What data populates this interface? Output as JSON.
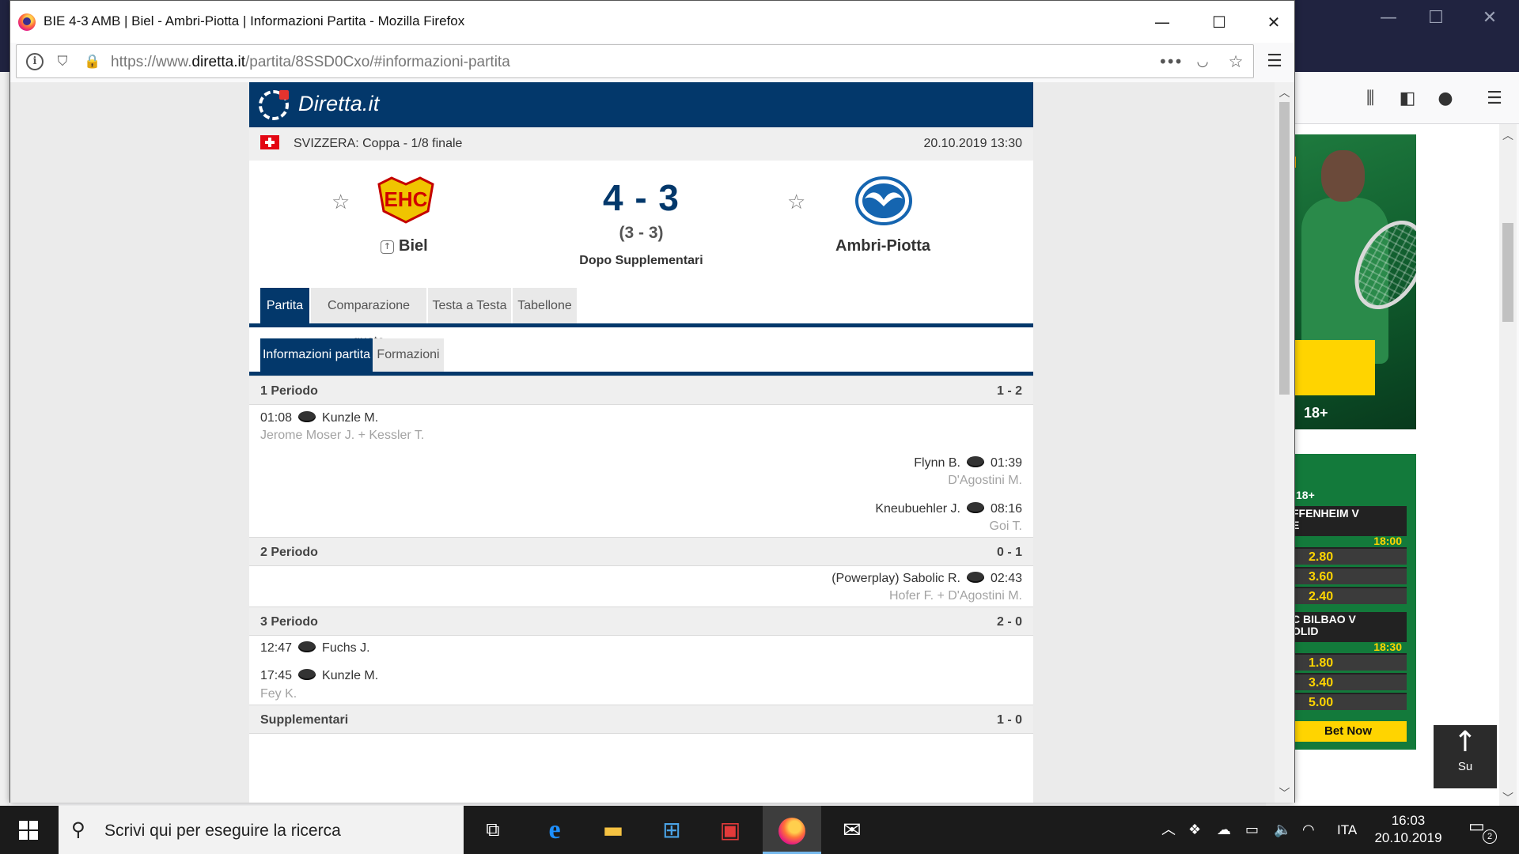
{
  "window": {
    "title": "BIE 4-3 AMB | Biel - Ambri-Piotta | Informazioni Partita - Mozilla Firefox",
    "url_prefix": "https://www.",
    "url_host": "diretta.it",
    "url_path": "/partita/8SSD0Cxo/#informazioni-partita"
  },
  "site": {
    "logo_text": "Diretta.it"
  },
  "competition": {
    "name": "SVIZZERA: Coppa - 1/8 finale",
    "datetime": "20.10.2019 13:30"
  },
  "match": {
    "home_team": "Biel",
    "away_team": "Ambri-Piotta",
    "score": "4 - 3",
    "score_regular": "(3 - 3)",
    "status": "Dopo Supplementari"
  },
  "tabs": [
    "Partita",
    "Comparazione quote",
    "Testa a Testa",
    "Tabellone"
  ],
  "subtabs": [
    "Informazioni partita",
    "Formazioni"
  ],
  "periods": [
    {
      "name": "1 Periodo",
      "result": "1 - 2",
      "events": [
        {
          "side": "home",
          "time": "01:08",
          "player": "Kunzle M.",
          "assist": "Jerome Moser J. + Kessler T."
        },
        {
          "side": "away",
          "time": "01:39",
          "player": "Flynn B.",
          "assist": "D'Agostini M."
        },
        {
          "side": "away",
          "time": "08:16",
          "player": "Kneubuehler J.",
          "assist": "Goi T."
        }
      ]
    },
    {
      "name": "2 Periodo",
      "result": "0 - 1",
      "events": [
        {
          "side": "away",
          "time": "02:43",
          "player": "(Powerplay) Sabolic R.",
          "assist": "Hofer F. + D'Agostini M."
        }
      ]
    },
    {
      "name": "3 Periodo",
      "result": "2 - 0",
      "events": [
        {
          "side": "home",
          "time": "12:47",
          "player": "Fuchs J.",
          "assist": ""
        },
        {
          "side": "home",
          "time": "17:45",
          "player": "Kunzle M.",
          "assist": "Fey K."
        }
      ]
    },
    {
      "name": "Supplementari",
      "result": "1 - 0",
      "events": []
    }
  ],
  "ads": {
    "tennis_age": "18+",
    "bet_age": "18+",
    "bets": [
      {
        "teams": "FFENHEIM V\nE",
        "time": "18:00",
        "odds": [
          "2.80",
          "3.60",
          "2.40"
        ]
      },
      {
        "teams": "C BILBAO V\nOLID",
        "time": "18:30",
        "odds": [
          "1.80",
          "3.40",
          "5.00"
        ]
      }
    ],
    "bet_button": "Bet Now"
  },
  "scroll_up_label": "Su",
  "taskbar": {
    "search_placeholder": "Scrivi qui per eseguire la ricerca",
    "language": "ITA",
    "time": "16:03",
    "date": "20.10.2019",
    "notifications": "2"
  },
  "colors": {
    "brand": "#03386b",
    "accent_red": "#e4332e",
    "bet_yellow": "#ffd400",
    "bet_green": "#137a3b"
  }
}
